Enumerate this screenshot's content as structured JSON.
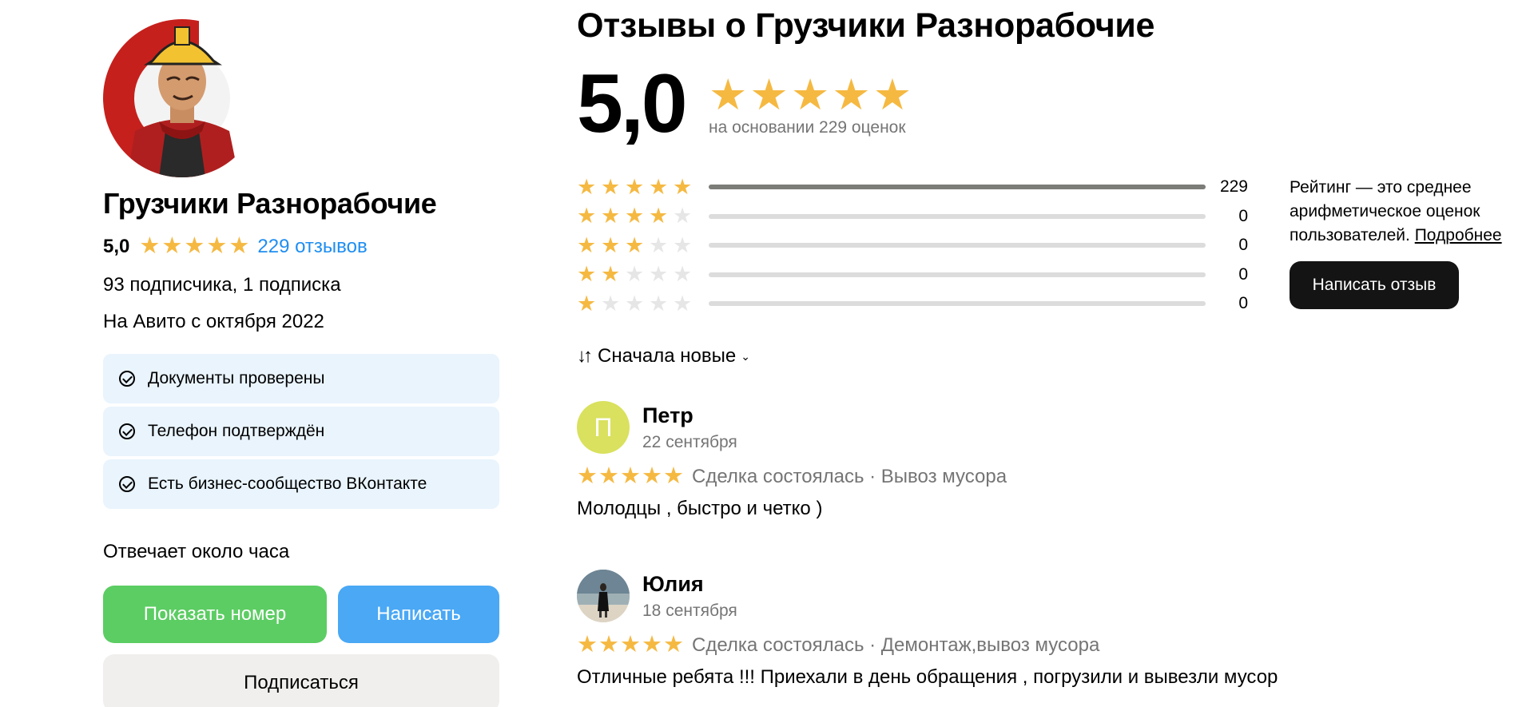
{
  "seller": {
    "name": "Грузчики Разнорабочие",
    "rating": "5,0",
    "stars_count": 5,
    "reviews_link": "229 отзывов",
    "subscriptions": "93 подписчика, 1 подписка",
    "since": "На Авито с октября 2022",
    "badges": [
      "Документы проверены",
      "Телефон подтверждён",
      "Есть бизнес-сообщество ВКонтакте"
    ],
    "response_time": "Отвечает около часа",
    "buttons": {
      "show_phone": "Показать номер",
      "write": "Написать",
      "subscribe": "Подписаться"
    }
  },
  "reviews_section": {
    "title": "Отзывы о Грузчики Разнорабочие",
    "score": "5,0",
    "based_on": "на основании 229 оценок",
    "distribution": [
      {
        "stars": 5,
        "count": "229",
        "fraction": 1.0
      },
      {
        "stars": 4,
        "count": "0",
        "fraction": 0
      },
      {
        "stars": 3,
        "count": "0",
        "fraction": 0
      },
      {
        "stars": 2,
        "count": "0",
        "fraction": 0
      },
      {
        "stars": 1,
        "count": "0",
        "fraction": 0
      }
    ],
    "rating_note": "Рейтинг — это среднее арифметическое оценок пользователей.",
    "rating_note_link": "Подробнее",
    "write_review_button": "Написать отзыв",
    "sort_label": "Сначала новые"
  },
  "reviews": [
    {
      "avatar_letter": "П",
      "name": "Петр",
      "date": "22 сентября",
      "stars": 5,
      "deal": "Сделка состоялась · Вывоз мусора",
      "text": "Молодцы , быстро и четко )"
    },
    {
      "avatar_letter": "",
      "name": "Юлия",
      "date": "18 сентября",
      "stars": 5,
      "deal": "Сделка состоялась · Демонтаж,вывоз мусора",
      "text": "Отличные ребята !!! Приехали в день обращения , погрузили и вывезли мусор"
    }
  ],
  "colors": {
    "star": "#f5b942",
    "link": "#1f8ef1",
    "badge_bg": "#e9f4fd",
    "green_button": "#5ccd63",
    "blue_button": "#4aa8f5",
    "dark_button": "#141414",
    "letter_avatar": "#d9e15e"
  }
}
